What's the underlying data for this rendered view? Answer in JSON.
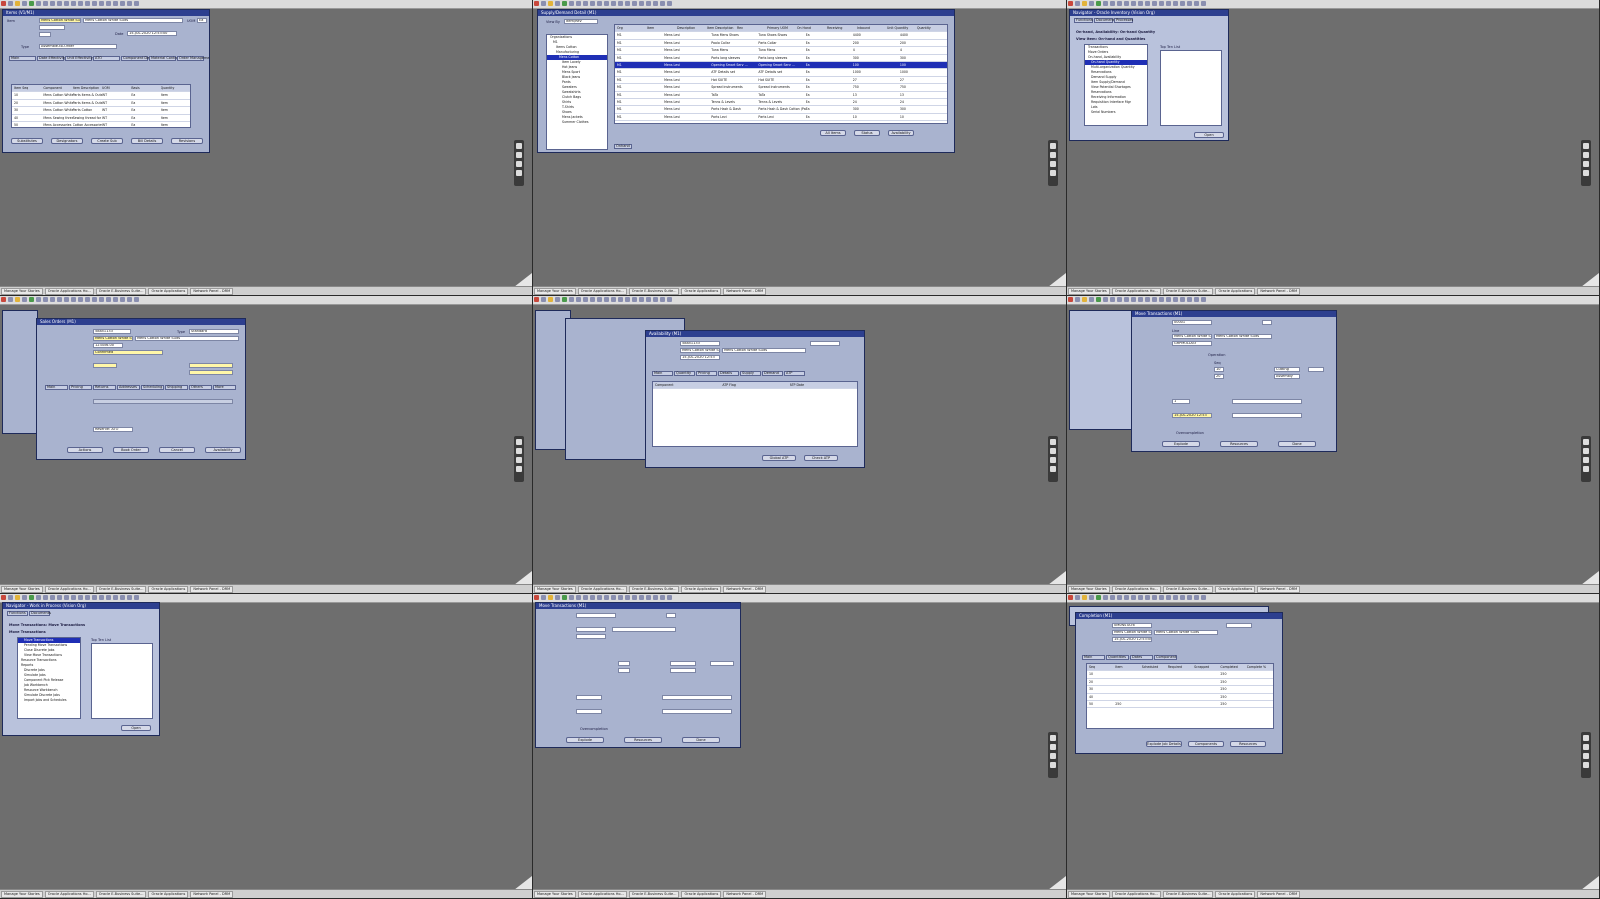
{
  "taskbar": [
    "Manage Your Stories",
    "Oracle Applications Ho...",
    "Oracle E-Business Suite...",
    "Oracle Applications",
    "Network Panel - DRM"
  ],
  "p1": {
    "title": "Items (V1/M1)",
    "item_label": "Item",
    "item_value": "Mens Cotton White Suits",
    "desc_value": "Mens Cotton White Suits",
    "uom_label": "UOM",
    "uom_value": "Ea",
    "date_label": "Date",
    "date_value": "15-JUL-2020 12:53:00",
    "type_label": "Type",
    "type_value": "Assemble-to-Order",
    "tabs": [
      "Main",
      "Date Effectivity",
      "Unit Effectivity",
      "ATO",
      "Component Details",
      "Material Control",
      "Order Management"
    ],
    "columns": [
      "Item Seq",
      "Component",
      "Item Description",
      "UOM",
      "Basis",
      "Quantity"
    ],
    "rows": [
      [
        "10",
        "Mens Cotton White Jacket",
        "Parts Items & Outerwear Parts",
        "WT",
        "Ea",
        "Item"
      ],
      [
        "20",
        "Mens Cotton White Pants",
        "Parts Items & Outerwear",
        "WT",
        "Ea",
        "Item"
      ],
      [
        "30",
        "Mens Cotton White Shirt",
        "Parts Cotton",
        "WT",
        "Ea",
        "Item"
      ],
      [
        "40",
        "Mens Sewing thread",
        "Sewing thread for items",
        "WT",
        "Ea",
        "Item"
      ],
      [
        "50",
        "Mens Accessories",
        "Cotton Accessories",
        "WT",
        "Ea",
        "Item"
      ]
    ],
    "buttons": [
      "Substitutes",
      "Designators",
      "Create Sub",
      "Bill Details",
      "Revisions"
    ]
  },
  "p2": {
    "title": "Supply/Demand Detail (M1)",
    "viewby_label": "View By",
    "viewby_value": "Item/Rev",
    "tree": [
      "Organizations",
      "M1",
      "Items Cotton",
      "Manufacturing",
      "Mens Cotton",
      "Item Lovely",
      "Hot Jeans",
      "Mens Sport",
      "Black Jeans",
      "Pants",
      "Sweaters",
      "Sweatshirts",
      "Clutch Bags",
      "Shirts",
      "T-Shirts",
      "Shoes",
      "Mens Jackets",
      "Summer Clothes"
    ],
    "columns": [
      "Org",
      "Item",
      "Description",
      "Item Description",
      "Rev",
      "Primary UOM",
      "On Hand",
      "Receiving",
      "Inbound",
      "Unit Quantity",
      "Quantity"
    ],
    "rows": [
      [
        "M1",
        "Mens Levi",
        "Tuna Mens Shoes",
        "Tuna Shoes Shoes",
        "Ea",
        "4400",
        "4400"
      ],
      [
        "M1",
        "Mens Levi",
        "Paolo Collar",
        "Parts Collar",
        "Ea",
        "200",
        "200"
      ],
      [
        "M1",
        "Mens Levi",
        "Tuna Mens",
        "Tuna Mens",
        "Ea",
        "4",
        "4"
      ],
      [
        "M1",
        "Mens Levi",
        "Parts long sleeves",
        "Parts long sleeves",
        "Ea",
        "300",
        "300"
      ],
      [
        "M1",
        "Mens Levi",
        "Opening Smart Serv ...",
        "Opening Smart Serv ...",
        "Ea",
        "100",
        "100"
      ],
      [
        "M1",
        "Mens Levi",
        "ATF Details set",
        "ATF Details set",
        "Ea",
        "1000",
        "1000"
      ],
      [
        "M1",
        "Mens Levi",
        "Hot SUITE",
        "Hot SUITE",
        "Ea",
        "27",
        "27"
      ],
      [
        "M1",
        "Mens Levi",
        "Spread instruments",
        "Spread instruments",
        "Ea",
        "750",
        "750"
      ],
      [
        "M1",
        "Mens Levi",
        "TaTa",
        "TaTa",
        "Ea",
        "13",
        "13"
      ],
      [
        "M1",
        "Mens Levi",
        "Tenns & Levels",
        "Tenns & Levels",
        "Ea",
        "24",
        "24"
      ],
      [
        "M1",
        "Mens Levi",
        "Parts Hash & Dash",
        "Parts Hash & Dash Cotton (Pair)",
        "Ea",
        "300",
        "300"
      ],
      [
        "M1",
        "Mens Levi",
        "Parts Levi",
        "Parts Levi",
        "Ea",
        "10",
        "10"
      ]
    ],
    "buttons": [
      "All Items",
      "Status",
      "Availability"
    ],
    "bottom_tab": "Onhand"
  },
  "p3": {
    "title": "Navigator - Oracle Inventory (Vision Org)",
    "tabs": [
      "Functions",
      "Documents",
      "Processes"
    ],
    "heading": "On-hand, Availability: On-hand Quantity",
    "subheading": "View Item: On-hand and Quantities",
    "list": [
      "Transactions",
      "Move Orders",
      "On-hand, Availability",
      "On-hand Quantity",
      "Multi-organization Quantity",
      "Reservations",
      "Demand Supply",
      "Item Supply/Demand",
      "View Potential Shortages",
      "Reservations",
      "Receiving Information",
      "Requisition Interface Mgr",
      "Lots",
      "Serial Numbers"
    ],
    "top_ten_label": "Top Ten List",
    "open_button": "Open"
  },
  "p4": {
    "title": "Sales Orders (M1)",
    "order_label": "Order",
    "order_value": "58851133",
    "order_type_label": "Type",
    "order_type_value": "Standard",
    "item_label": "Item",
    "item_value": "Mens Cotton White Su",
    "item_desc_value": "Mens Cotton White Suits",
    "qty_value": "123456.00",
    "status_value": "Confirmed",
    "tabs": [
      "Main",
      "Pricing",
      "Returns",
      "Addresses",
      "Scheduling",
      "Shipping",
      "Others",
      "More"
    ],
    "buttons": [
      "Actions",
      "Book Order",
      "Cancel",
      "Availability"
    ],
    "reserve_value": "Reserve: ATO"
  },
  "p5": {
    "title": "Availability (M1)",
    "order_value": "58851133",
    "item_value": "Mens Cotton White Su",
    "item_desc_value": "Mens Cotton White Suits",
    "date_value": "15-JUL-2020 12:53",
    "tabs": [
      "Main",
      "Quantity",
      "Pricing",
      "Details",
      "Supply",
      "Demand",
      "ATP"
    ],
    "grid_headers": [
      "Component",
      "ATP Flag",
      "ATP Date"
    ],
    "buttons": [
      "Global ATP",
      "Check ATP"
    ]
  },
  "p6": {
    "title": "Move Transactions (M1)",
    "job_value": "00001",
    "item_value": "Mens Cotton White S",
    "item_desc_value": "Mens Cotton White Suits",
    "assembly_value": "GRPMOLD03",
    "line_label": "Line",
    "operation_label": "Operation",
    "seq_label": "Seq",
    "seq_from": "10",
    "seq_to": "20",
    "dept_from": "Cutting",
    "dept_to": "Assembly",
    "qty_value": "1",
    "date_value": "15-JUL-2020 12:53",
    "buttons": [
      "Explode",
      "Resources",
      "Done"
    ],
    "overcompletion_label": "Overcompletion"
  },
  "p7": {
    "title": "Navigator - Work in Process (Vision Org)",
    "tabs": [
      "Functions",
      "Documents"
    ],
    "heading": "Move Transactions: Move Transactions",
    "subheading": "Move Transactions",
    "list": [
      "Move Transactions",
      "Pending Move Transactions",
      "Close Discrete Jobs",
      "View Move Transactions",
      "Resource Transactions",
      "Reports",
      "Discrete Jobs",
      "Simulate Jobs",
      "Component Pick Release",
      "Job Workbench",
      "Resource Workbench",
      "Simulate Discrete Jobs",
      "Import Jobs and Schedules"
    ],
    "top_ten_label": "Top Ten List",
    "open_button": "Open"
  },
  "p8": {
    "title": "Move Transactions (M1)",
    "buttons": [
      "Explode",
      "Resources",
      "Done"
    ],
    "overcompletion_label": "Overcompletion"
  },
  "p9": {
    "title": "Completion (M1)",
    "job_value": "0M0NSTAT6",
    "item_value": "Mens Cotton White Su",
    "item_desc_value": "Mens Cotton White Suits",
    "date_value": "15-JUL-2020 12:53:00",
    "tabs": [
      "Main",
      "Quantities",
      "Dates",
      "Component"
    ],
    "columns": [
      "Seq",
      "Item",
      "Scheduled",
      "Required",
      "Scrapped",
      "Completed",
      "Complete %"
    ],
    "rows": [
      [
        "10",
        "",
        "",
        "",
        "",
        "250",
        ""
      ],
      [
        "20",
        "",
        "",
        "",
        "",
        "250",
        ""
      ],
      [
        "30",
        "",
        "",
        "",
        "",
        "250",
        ""
      ],
      [
        "40",
        "",
        "",
        "",
        "",
        "250",
        ""
      ],
      [
        "50",
        "250",
        "",
        "",
        "",
        "250",
        ""
      ]
    ],
    "buttons": [
      "Explode Job Details",
      "Components",
      "Resources"
    ]
  }
}
